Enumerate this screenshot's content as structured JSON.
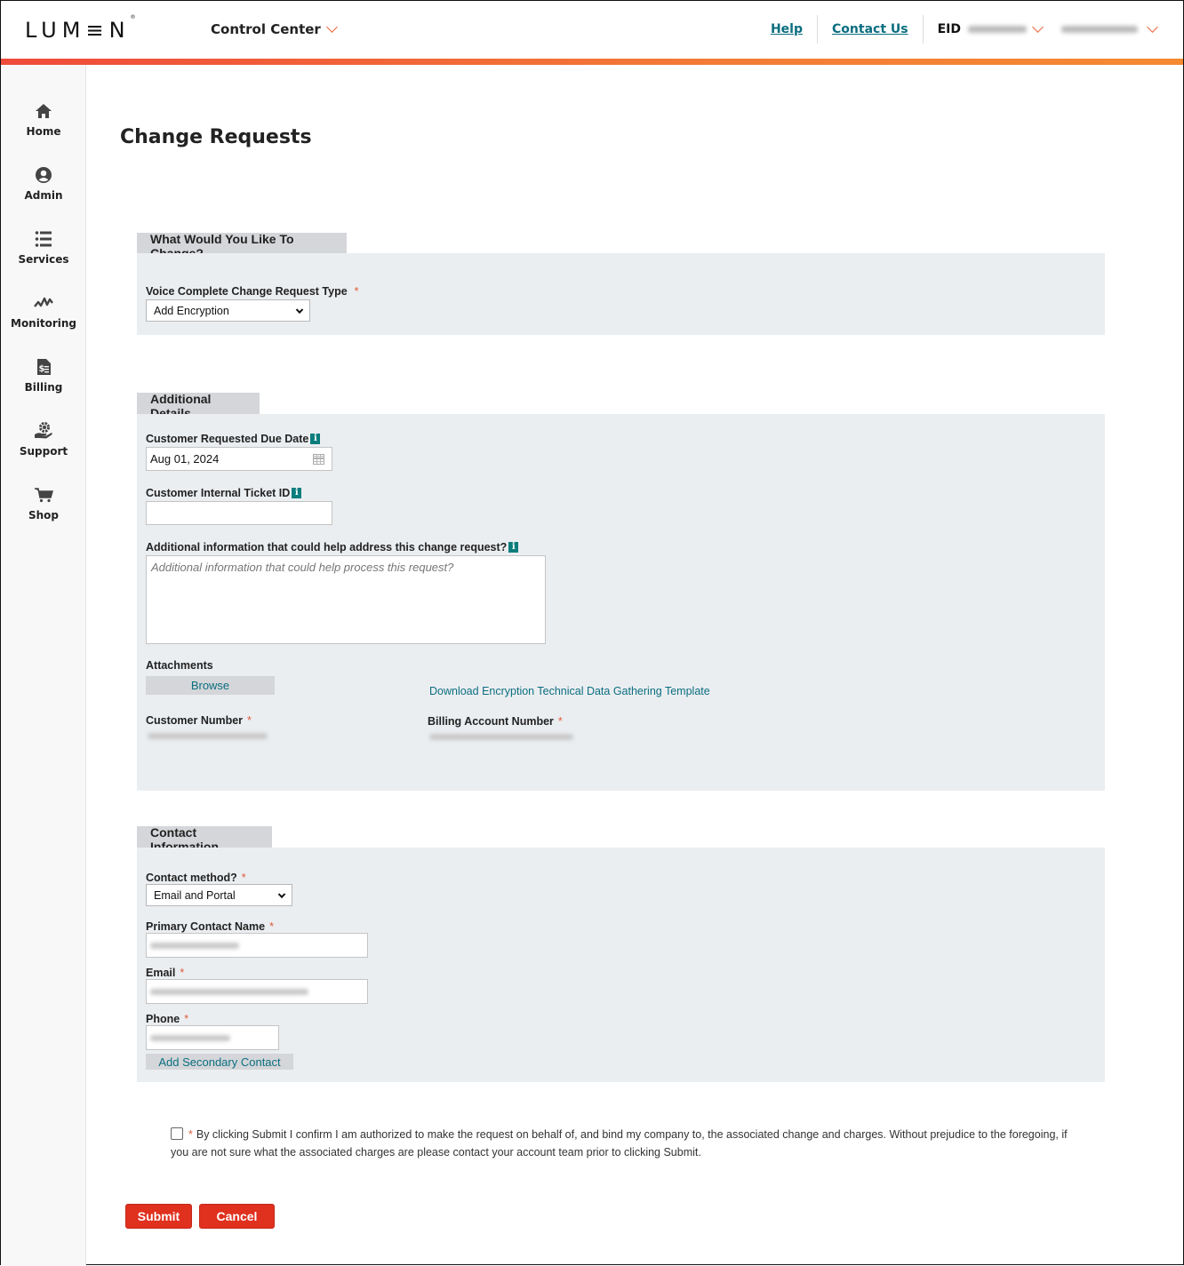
{
  "header": {
    "logo": "LUMEN",
    "app_switcher": "Control Center",
    "links": {
      "help": "Help",
      "contact": "Contact Us"
    },
    "eid_label": "EID",
    "eid_value": "[redacted]",
    "user_value": "[redacted]"
  },
  "sidebar": {
    "items": [
      {
        "label": "Home",
        "icon": "home-icon"
      },
      {
        "label": "Admin",
        "icon": "user-circle-icon"
      },
      {
        "label": "Services",
        "icon": "list-icon"
      },
      {
        "label": "Monitoring",
        "icon": "pulse-icon"
      },
      {
        "label": "Billing",
        "icon": "invoice-icon"
      },
      {
        "label": "Support",
        "icon": "support-gear-hand-icon"
      },
      {
        "label": "Shop",
        "icon": "cart-icon"
      }
    ]
  },
  "page": {
    "title": "Change Requests"
  },
  "change_section": {
    "tab": "What Would You Like To Change?",
    "type_label": "Voice Complete Change Request Type",
    "type_required": "*",
    "type_value": "Add Encryption"
  },
  "details_section": {
    "tab": "Additional Details",
    "due_date_label": "Customer Requested Due Date",
    "due_date_value": "Aug 01, 2024",
    "ticket_label": "Customer Internal Ticket ID",
    "ticket_value": "",
    "additional_label": "Additional information that could help address this change request?",
    "additional_placeholder": "Additional information that could help process this request?",
    "attachments_label": "Attachments",
    "browse_label": "Browse",
    "template_link": "Download Encryption Technical Data Gathering Template",
    "customer_number_label": "Customer Number",
    "customer_number_value": "[redacted]",
    "ban_label": "Billing Account Number",
    "ban_value": "[redacted]",
    "required_mark": "*",
    "info_glyph": "i"
  },
  "contact_section": {
    "tab": "Contact Information",
    "method_label": "Contact method?",
    "method_value": "Email and Portal",
    "primary_name_label": "Primary Contact Name",
    "primary_name_value": "[redacted]",
    "email_label": "Email",
    "email_value": "[redacted]",
    "phone_label": "Phone",
    "phone_value": "[redacted]",
    "add_secondary_label": "Add Secondary Contact",
    "required_mark": "*"
  },
  "confirmation": {
    "checked": false,
    "required_mark": "*",
    "text": "By clicking Submit I confirm I am authorized to make the request on behalf of, and bind my company to, the associated change and charges. Without prejudice to the foregoing, if you are not sure what the associated charges are please contact your account team prior to clicking Submit."
  },
  "actions": {
    "submit": "Submit",
    "cancel": "Cancel"
  },
  "colors": {
    "brand_orange": "#f37b37",
    "brand_red": "#ef4b3a",
    "link_teal": "#0b6e80",
    "button_red": "#e0301e",
    "panel_bg": "#ebeef1"
  }
}
